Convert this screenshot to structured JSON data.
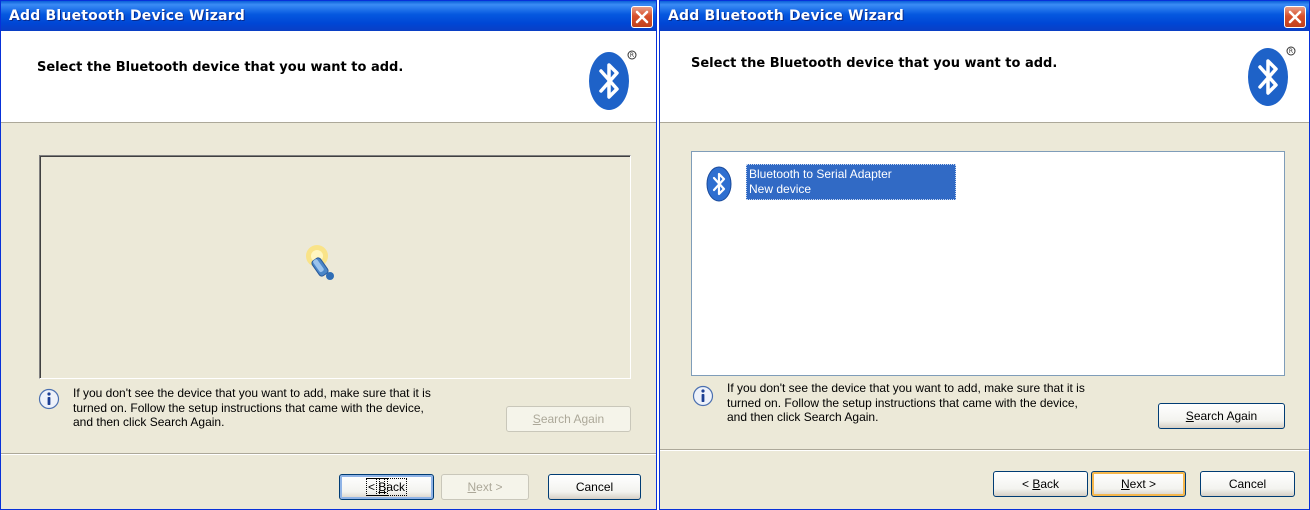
{
  "windows": [
    {
      "title": "Add Bluetooth Device Wizard",
      "header": "Select the Bluetooth device that you want to add.",
      "state": "searching",
      "info_lines": [
        "If you don't see the device that you want to add, make sure that it is",
        "turned on. Follow the setup instructions that came with the device,",
        "and then click Search Again."
      ],
      "search_again": {
        "pre": "",
        "accel": "S",
        "post": "earch Again",
        "enabled": false
      },
      "back": {
        "pre": "< ",
        "accel": "B",
        "post": "ack",
        "enabled": true
      },
      "next": {
        "pre": "",
        "accel": "N",
        "post": "ext >",
        "enabled": false
      },
      "cancel": {
        "label": "Cancel",
        "enabled": true
      }
    },
    {
      "title": "Add Bluetooth Device Wizard",
      "header": "Select the Bluetooth device that you want to add.",
      "state": "found",
      "devices": [
        {
          "name": "Bluetooth to Serial Adapter",
          "status": "New device",
          "selected": true,
          "icon": "bluetooth-device-icon"
        }
      ],
      "info_lines": [
        "If you don't see the device that you want to add, make sure that it is",
        "turned on. Follow the setup instructions that came with the device,",
        "and then click Search Again."
      ],
      "search_again": {
        "pre": "",
        "accel": "S",
        "post": "earch Again",
        "enabled": true
      },
      "back": {
        "pre": "< ",
        "accel": "B",
        "post": "ack",
        "enabled": true
      },
      "next": {
        "pre": "",
        "accel": "N",
        "post": "ext >",
        "enabled": true
      },
      "cancel": {
        "label": "Cancel",
        "enabled": true
      }
    }
  ],
  "colors": {
    "title_bar": "#0055e5",
    "selection": "#316ac5",
    "dialog_bg": "#ece9d8",
    "bluetooth_blue": "#1e62c8"
  }
}
